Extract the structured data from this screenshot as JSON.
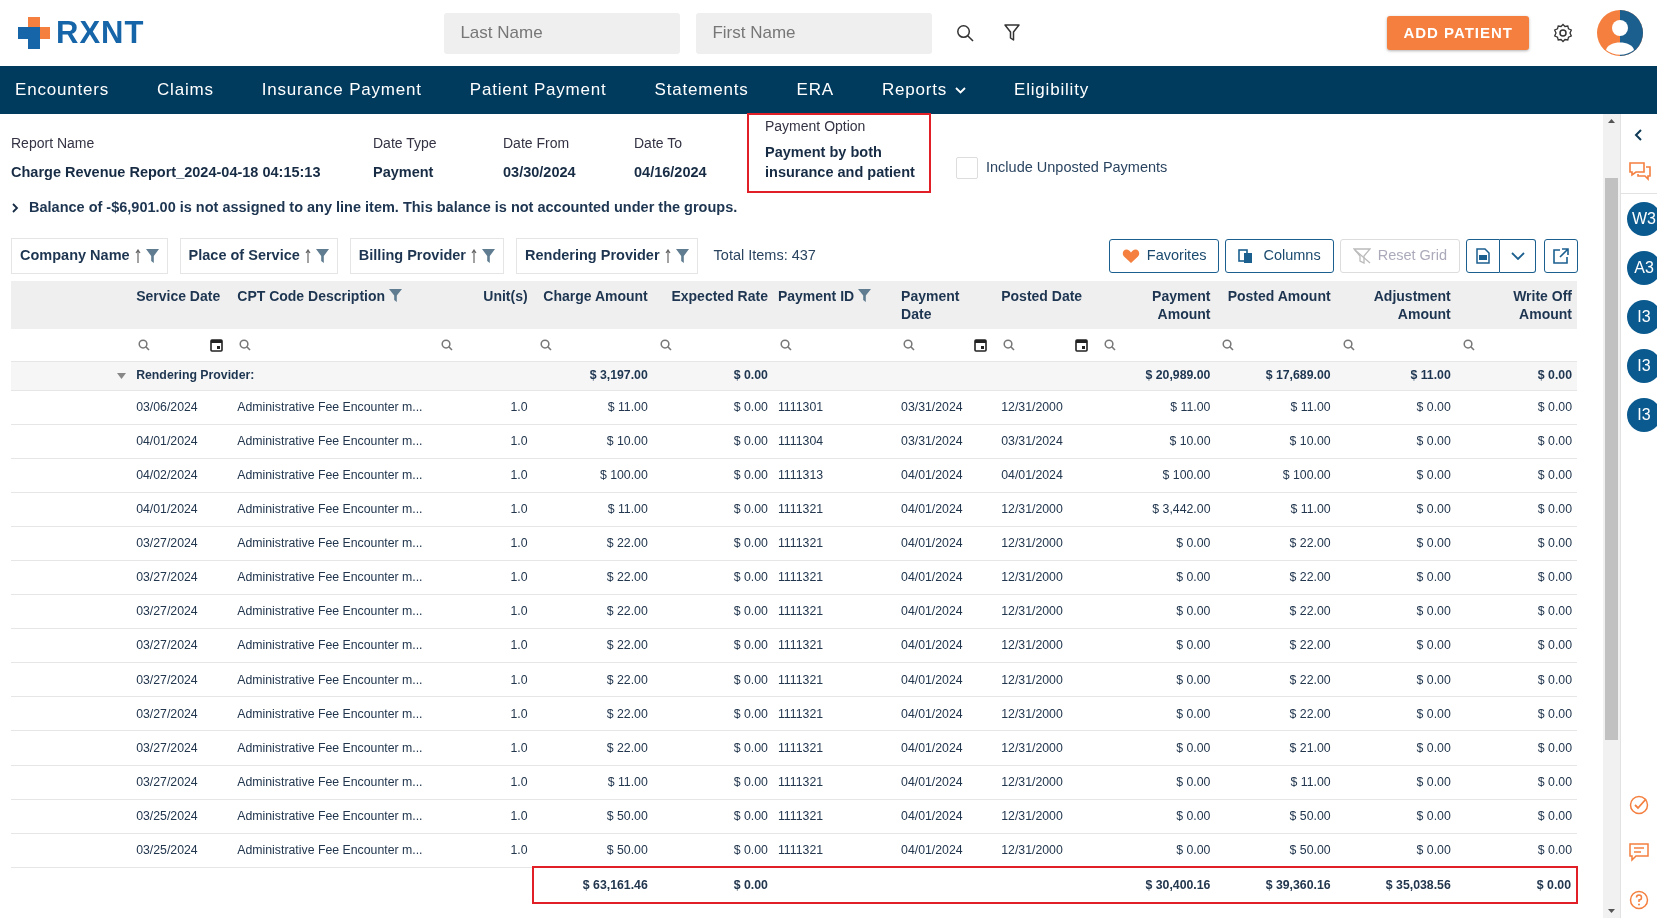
{
  "header": {
    "logo_text": "RXNT",
    "last_name": {
      "placeholder": "Last Name"
    },
    "first_name": {
      "placeholder": "First Name"
    },
    "add_button": "ADD PATIENT"
  },
  "nav": [
    {
      "label": "Encounters",
      "dropdown": false
    },
    {
      "label": "Claims",
      "dropdown": false
    },
    {
      "label": "Insurance Payment",
      "dropdown": false
    },
    {
      "label": "Patient Payment",
      "dropdown": false
    },
    {
      "label": "Statements",
      "dropdown": false
    },
    {
      "label": "ERA",
      "dropdown": false
    },
    {
      "label": "Reports",
      "dropdown": true
    },
    {
      "label": "Eligibility",
      "dropdown": false
    }
  ],
  "report_fields": [
    {
      "label": "Report Name",
      "value": "Charge Revenue Report_2024-04-18 04:15:13",
      "highlighted": false
    },
    {
      "label": "Date Type",
      "value": "Payment",
      "highlighted": false
    },
    {
      "label": "Date From",
      "value": "03/30/2024",
      "highlighted": false
    },
    {
      "label": "Date To",
      "value": "04/16/2024",
      "highlighted": false
    },
    {
      "label": "Payment Option",
      "value": "Payment by both insurance and patient",
      "highlighted": true
    }
  ],
  "include_unposted": {
    "label": "Include Unposted Payments",
    "checked": false
  },
  "balance_note": {
    "text": "Balance of -$6,901.00 is not assigned to any line item. This balance is not accounted under the groups.",
    "expanded": false
  },
  "group_chips": [
    {
      "label": "Company Name"
    },
    {
      "label": "Place of Service"
    },
    {
      "label": "Billing Provider"
    },
    {
      "label": "Rendering Provider"
    }
  ],
  "total_items": "Total Items: 437",
  "toolbar": [
    {
      "kind": "favorites",
      "label": "Favorites",
      "disabled": false
    },
    {
      "kind": "columns",
      "label": "Columns",
      "disabled": false
    },
    {
      "kind": "reset",
      "label": "Reset Grid",
      "disabled": true
    }
  ],
  "table": {
    "columns": [
      {
        "label": "Service Date",
        "kind": "date",
        "filtered": false,
        "summed": false
      },
      {
        "label": "CPT Code Description",
        "kind": "text",
        "filtered": true,
        "summed": false
      },
      {
        "label": "Unit(s)",
        "kind": "number",
        "filtered": false,
        "summed": false
      },
      {
        "label": "Charge Amount",
        "kind": "number",
        "filtered": false,
        "summed": true
      },
      {
        "label": "Expected Rate",
        "kind": "number",
        "filtered": false,
        "summed": true
      },
      {
        "label": "Payment ID",
        "kind": "text",
        "filtered": true,
        "summed": false
      },
      {
        "label": "Payment Date",
        "kind": "date",
        "filtered": false,
        "summed": false
      },
      {
        "label": "Posted Date",
        "kind": "date",
        "filtered": false,
        "summed": false
      },
      {
        "label": "Payment Amount",
        "kind": "number",
        "filtered": false,
        "summed": true
      },
      {
        "label": "Posted Amount",
        "kind": "number",
        "filtered": false,
        "summed": true
      },
      {
        "label": "Adjustment Amount",
        "kind": "number",
        "filtered": false,
        "summed": true
      },
      {
        "label": "Write Off Amount",
        "kind": "number",
        "filtered": false,
        "summed": true
      }
    ],
    "group": {
      "label": "Rendering Provider:",
      "expanded": true,
      "subtotals": [
        "$ 3,197.00",
        "$ 0.00",
        "$ 20,989.00",
        "$ 17,689.00",
        "$ 11.00",
        "$ 0.00"
      ]
    },
    "rows": [
      [
        "03/06/2024",
        "Administrative Fee Encounter m...",
        "1.0",
        "$ 11.00",
        "$ 0.00",
        "1111301",
        "03/31/2024",
        "12/31/2000",
        "$ 11.00",
        "$ 11.00",
        "$ 0.00",
        "$ 0.00"
      ],
      [
        "04/01/2024",
        "Administrative Fee Encounter m...",
        "1.0",
        "$ 10.00",
        "$ 0.00",
        "1111304",
        "03/31/2024",
        "03/31/2024",
        "$ 10.00",
        "$ 10.00",
        "$ 0.00",
        "$ 0.00"
      ],
      [
        "04/02/2024",
        "Administrative Fee Encounter m...",
        "1.0",
        "$ 100.00",
        "$ 0.00",
        "1111313",
        "04/01/2024",
        "04/01/2024",
        "$ 100.00",
        "$ 100.00",
        "$ 0.00",
        "$ 0.00"
      ],
      [
        "04/01/2024",
        "Administrative Fee Encounter m...",
        "1.0",
        "$ 11.00",
        "$ 0.00",
        "1111321",
        "04/01/2024",
        "12/31/2000",
        "$ 3,442.00",
        "$ 11.00",
        "$ 0.00",
        "$ 0.00"
      ],
      [
        "03/27/2024",
        "Administrative Fee Encounter m...",
        "1.0",
        "$ 22.00",
        "$ 0.00",
        "1111321",
        "04/01/2024",
        "12/31/2000",
        "$ 0.00",
        "$ 22.00",
        "$ 0.00",
        "$ 0.00"
      ],
      [
        "03/27/2024",
        "Administrative Fee Encounter m...",
        "1.0",
        "$ 22.00",
        "$ 0.00",
        "1111321",
        "04/01/2024",
        "12/31/2000",
        "$ 0.00",
        "$ 22.00",
        "$ 0.00",
        "$ 0.00"
      ],
      [
        "03/27/2024",
        "Administrative Fee Encounter m...",
        "1.0",
        "$ 22.00",
        "$ 0.00",
        "1111321",
        "04/01/2024",
        "12/31/2000",
        "$ 0.00",
        "$ 22.00",
        "$ 0.00",
        "$ 0.00"
      ],
      [
        "03/27/2024",
        "Administrative Fee Encounter m...",
        "1.0",
        "$ 22.00",
        "$ 0.00",
        "1111321",
        "04/01/2024",
        "12/31/2000",
        "$ 0.00",
        "$ 22.00",
        "$ 0.00",
        "$ 0.00"
      ],
      [
        "03/27/2024",
        "Administrative Fee Encounter m...",
        "1.0",
        "$ 22.00",
        "$ 0.00",
        "1111321",
        "04/01/2024",
        "12/31/2000",
        "$ 0.00",
        "$ 22.00",
        "$ 0.00",
        "$ 0.00"
      ],
      [
        "03/27/2024",
        "Administrative Fee Encounter m...",
        "1.0",
        "$ 22.00",
        "$ 0.00",
        "1111321",
        "04/01/2024",
        "12/31/2000",
        "$ 0.00",
        "$ 22.00",
        "$ 0.00",
        "$ 0.00"
      ],
      [
        "03/27/2024",
        "Administrative Fee Encounter m...",
        "1.0",
        "$ 22.00",
        "$ 0.00",
        "1111321",
        "04/01/2024",
        "12/31/2000",
        "$ 0.00",
        "$ 21.00",
        "$ 0.00",
        "$ 0.00"
      ],
      [
        "03/27/2024",
        "Administrative Fee Encounter m...",
        "1.0",
        "$ 11.00",
        "$ 0.00",
        "1111321",
        "04/01/2024",
        "12/31/2000",
        "$ 0.00",
        "$ 11.00",
        "$ 0.00",
        "$ 0.00"
      ],
      [
        "03/25/2024",
        "Administrative Fee Encounter m...",
        "1.0",
        "$ 50.00",
        "$ 0.00",
        "1111321",
        "04/01/2024",
        "12/31/2000",
        "$ 0.00",
        "$ 50.00",
        "$ 0.00",
        "$ 0.00"
      ],
      [
        "03/25/2024",
        "Administrative Fee Encounter m...",
        "1.0",
        "$ 50.00",
        "$ 0.00",
        "1111321",
        "04/01/2024",
        "12/31/2000",
        "$ 0.00",
        "$ 50.00",
        "$ 0.00",
        "$ 0.00"
      ]
    ],
    "totals": {
      "highlighted": true,
      "values": [
        "$ 63,161.46",
        "$ 0.00",
        "$ 30,400.16",
        "$ 39,360.16",
        "$ 35,038.56",
        "$ 0.00"
      ]
    }
  },
  "rail": {
    "badges": [
      {
        "label": "W3"
      },
      {
        "label": "A3"
      },
      {
        "label": "I3"
      },
      {
        "label": "I3"
      },
      {
        "label": "I3"
      }
    ]
  }
}
